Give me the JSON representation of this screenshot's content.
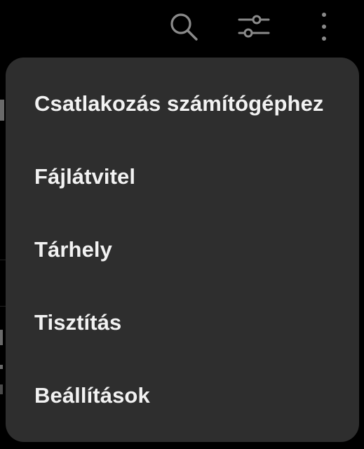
{
  "toolbar": {
    "search_icon": "search-icon",
    "filter_icon": "sliders-icon",
    "more_icon": "more-vertical-icon"
  },
  "menu": {
    "items": [
      {
        "label": "Csatlakozás számítógéphez"
      },
      {
        "label": "Fájlátvitel"
      },
      {
        "label": "Tárhely"
      },
      {
        "label": "Tisztítás"
      },
      {
        "label": "Beállítások"
      }
    ]
  },
  "colors": {
    "background": "#000000",
    "menu_background": "#2e2e2e",
    "menu_text": "#f2f2f2",
    "icon": "#8a8a8a"
  }
}
